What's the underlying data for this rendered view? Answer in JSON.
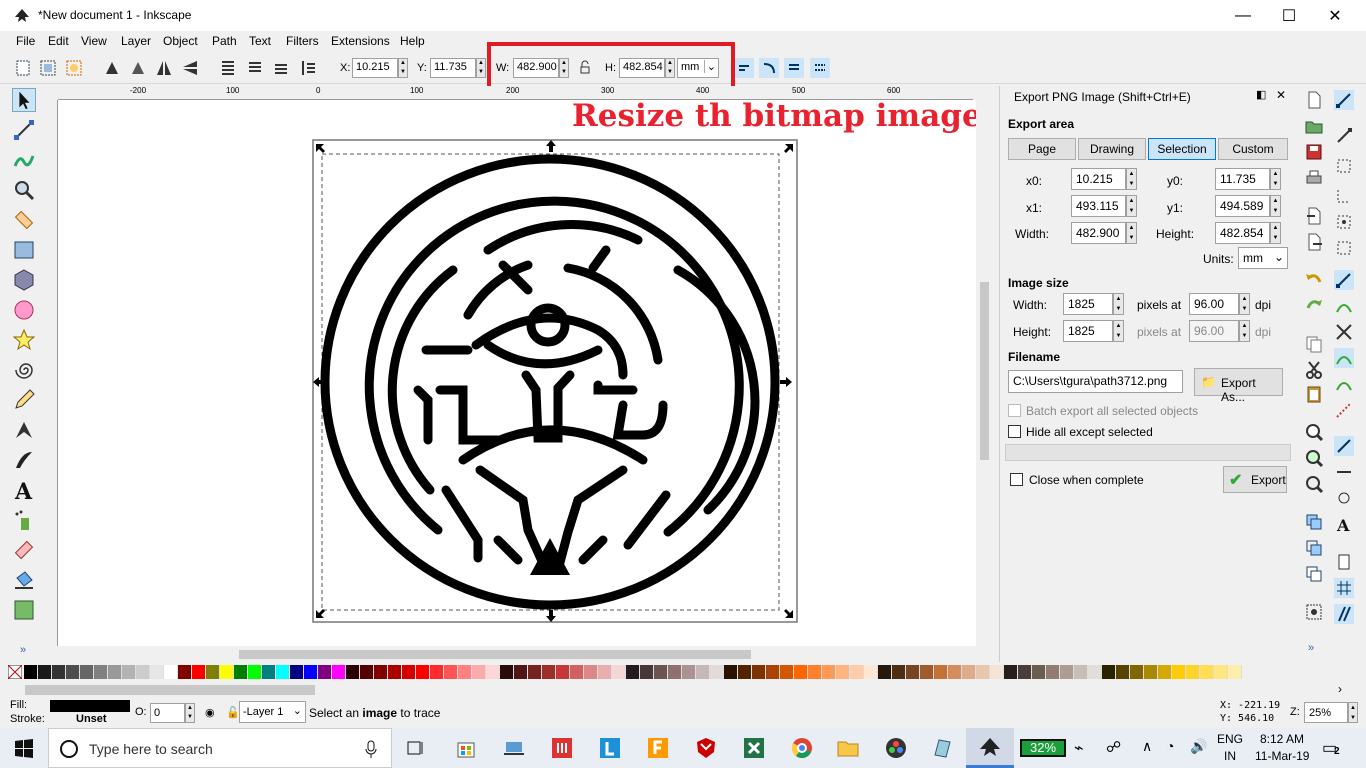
{
  "window": {
    "title": "*New document 1 - Inkscape",
    "minimize": "—",
    "maximize": "☐",
    "close": "✕"
  },
  "menu": [
    "File",
    "Edit",
    "View",
    "Layer",
    "Object",
    "Path",
    "Text",
    "Filters",
    "Extensions",
    "Help"
  ],
  "toolbar": {
    "x_label": "X:",
    "x_value": "10.215",
    "y_label": "Y:",
    "y_value": "11.735",
    "w_label": "W:",
    "w_value": "482.900",
    "h_label": "H:",
    "h_value": "482.854",
    "unit": "mm"
  },
  "annotation": "Resize th bitmap image",
  "ruler_labels": [
    "-200",
    "100",
    "0",
    "100",
    "200",
    "300",
    "400",
    "500",
    "600"
  ],
  "export_dialog": {
    "title": "Export PNG Image (Shift+Ctrl+E)",
    "export_area": "Export area",
    "tabs": [
      "Page",
      "Drawing",
      "Selection",
      "Custom"
    ],
    "active_tab": "Selection",
    "x0_label": "x0:",
    "x0": "10.215",
    "y0_label": "y0:",
    "y0": "11.735",
    "x1_label": "x1:",
    "x1": "493.115",
    "y1_label": "y1:",
    "y1": "494.589",
    "width_label": "Width:",
    "width": "482.900",
    "height_label": "Height:",
    "height": "482.854",
    "units_label": "Units:",
    "units": "mm",
    "image_size": "Image size",
    "img_width_label": "Width:",
    "img_width": "1825",
    "img_height_label": "Height:",
    "img_height": "1825",
    "pixels_at": "pixels at",
    "dpi1": "96.00",
    "dpi2": "96.00",
    "dpi_label": "dpi",
    "filename_label": "Filename",
    "filename": "C:\\Users\\tgura\\path3712.png",
    "export_as": "Export As...",
    "batch_export": "Batch export all selected objects",
    "hide_all": "Hide all except selected",
    "close_when_complete": "Close when complete",
    "export": "Export"
  },
  "status": {
    "fill_label": "Fill:",
    "stroke_label": "Stroke:",
    "stroke_value": "Unset",
    "opacity_label": "O:",
    "opacity_value": "0",
    "layer": "-Layer 1",
    "message_pre": "Select an ",
    "message_bold": "image",
    "message_post": " to trace",
    "x_coord": "X: -221.19",
    "y_coord": "Y:  546.10",
    "zoom_label": "Z:",
    "zoom": "25%"
  },
  "taskbar": {
    "search_placeholder": "Type here to search",
    "battery": "32%",
    "lang1": "ENG",
    "lang2": "IN",
    "time": "8:12 AM",
    "date": "11-Mar-19",
    "notifications": "2"
  },
  "palette_colors": [
    "#000000",
    "#1a1a1a",
    "#333333",
    "#4d4d4d",
    "#666666",
    "#808080",
    "#999999",
    "#b3b3b3",
    "#cccccc",
    "#e6e6e6",
    "#ffffff",
    "#800000",
    "#ff0000",
    "#808000",
    "#ffff00",
    "#008000",
    "#00ff00",
    "#008080",
    "#00ffff",
    "#000080",
    "#0000ff",
    "#800080",
    "#ff00ff",
    "#2b0000",
    "#550000",
    "#800000",
    "#aa0000",
    "#d40000",
    "#ff0000",
    "#ff2a2a",
    "#ff5555",
    "#ff8080",
    "#ffaaaa",
    "#ffd5d5",
    "#280b0b",
    "#501616",
    "#782121",
    "#a02c2c",
    "#c83737",
    "#d35f5f",
    "#de8787",
    "#e9afaf",
    "#f4d7d7",
    "#241c1c",
    "#483737",
    "#6c5353",
    "#916f6f",
    "#ac9393",
    "#c8b7b7",
    "#e3dbdb",
    "#2b1100",
    "#552200",
    "#803300",
    "#aa4400",
    "#d45500",
    "#ff6600",
    "#ff7f2a",
    "#ff9955",
    "#ffb380",
    "#ffccaa",
    "#ffe6d5",
    "#28170b",
    "#502d16",
    "#784421",
    "#a05a2c",
    "#c87137",
    "#d38d5f",
    "#deaa87",
    "#e9c6af",
    "#f4e3d7",
    "#241f1c",
    "#483e37",
    "#6c5d53",
    "#917c6f",
    "#ac9d93",
    "#c8beb7",
    "#e3dedb",
    "#2b2200",
    "#554400",
    "#806600",
    "#aa8800",
    "#d4aa00",
    "#ffcc00",
    "#ffd42a",
    "#ffdd55",
    "#ffe680",
    "#ffeeaa"
  ]
}
